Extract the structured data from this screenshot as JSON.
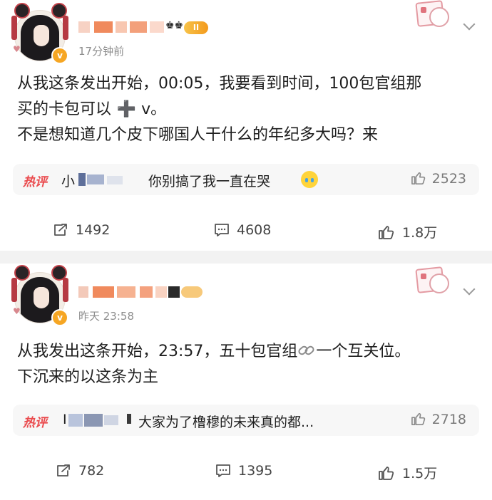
{
  "posts": [
    {
      "time": "17分钟前",
      "level_badge": "II",
      "content_lines": [
        "从我这条发出开始，00:05，我要看到时间，100包官组那",
        "买的卡包可以",
        " v。",
        "不是想知道几个皮下哪国人干什么的年纪多大吗？来"
      ],
      "hot_comment": {
        "tag": "热评",
        "commenter_prefix": "小",
        "text": "你别搞了我一直在哭",
        "emoji": "crying-face-icon",
        "likes": "2523"
      },
      "actions": {
        "reposts": "1492",
        "comments": "4608",
        "likes": "1.8万"
      }
    },
    {
      "time": "昨天 23:58",
      "content_lines": [
        "从我发出这条开始，23:57，五十包官组",
        "一个互关位。",
        "下沉来的以这条为主"
      ],
      "hot_comment": {
        "tag": "热评",
        "commenter_prefix": "I",
        "text": "大家为了橹穆的未来真的都...",
        "likes": "2718"
      },
      "actions": {
        "reposts": "782",
        "comments": "1395",
        "likes": "1.5万"
      }
    }
  ],
  "colors": {
    "hot_tag": "#ea4a4d",
    "vip_badge": "#f6a623",
    "divider": "#f2f2f2"
  }
}
